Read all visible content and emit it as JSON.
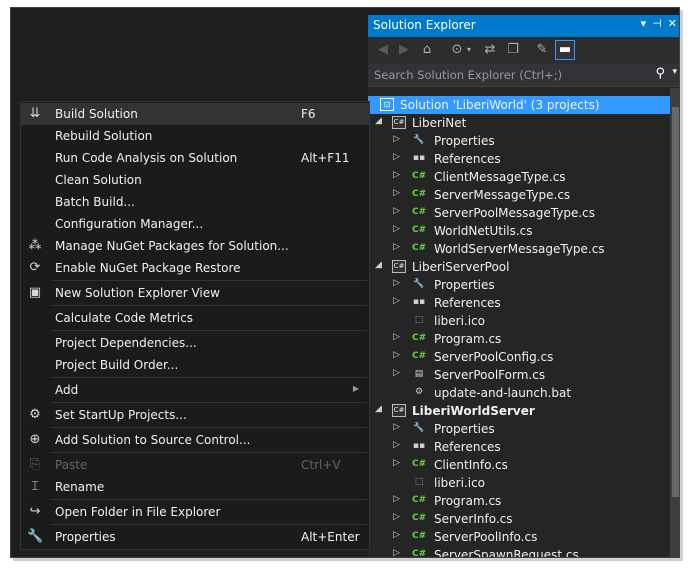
{
  "solution_explorer": {
    "title": "Solution Explorer",
    "title_buttons": [
      "▾",
      "⊣",
      "✕"
    ],
    "search_placeholder": "Search Solution Explorer (Ctrl+;)",
    "tree": [
      {
        "label": "Solution 'LiberiWorld' (3 projects)",
        "icon": "solution-icon",
        "level": 0,
        "expand": "",
        "selected": true
      },
      {
        "label": "LiberiNet",
        "icon": "csharp-project-icon",
        "level": 0,
        "expand": "open"
      },
      {
        "label": "Properties",
        "icon": "wrench-icon",
        "level": 1,
        "expand": "closed"
      },
      {
        "label": "References",
        "icon": "references-icon",
        "level": 1,
        "expand": "closed"
      },
      {
        "label": "ClientMessageType.cs",
        "icon": "csharp-file-icon",
        "level": 1,
        "expand": "closed"
      },
      {
        "label": "ServerMessageType.cs",
        "icon": "csharp-file-icon",
        "level": 1,
        "expand": "closed"
      },
      {
        "label": "ServerPoolMessageType.cs",
        "icon": "csharp-file-icon",
        "level": 1,
        "expand": "closed"
      },
      {
        "label": "WorldNetUtils.cs",
        "icon": "csharp-file-icon",
        "level": 1,
        "expand": "closed"
      },
      {
        "label": "WorldServerMessageType.cs",
        "icon": "csharp-file-icon",
        "level": 1,
        "expand": "closed"
      },
      {
        "label": "LiberiServerPool",
        "icon": "csharp-project-icon",
        "level": 0,
        "expand": "open"
      },
      {
        "label": "Properties",
        "icon": "wrench-icon",
        "level": 1,
        "expand": "closed"
      },
      {
        "label": "References",
        "icon": "references-icon",
        "level": 1,
        "expand": "closed"
      },
      {
        "label": "liberi.ico",
        "icon": "ico-file-icon",
        "level": 1,
        "expand": ""
      },
      {
        "label": "Program.cs",
        "icon": "csharp-file-icon",
        "level": 1,
        "expand": "closed"
      },
      {
        "label": "ServerPoolConfig.cs",
        "icon": "csharp-file-icon",
        "level": 1,
        "expand": "closed"
      },
      {
        "label": "ServerPoolForm.cs",
        "icon": "form-file-icon",
        "level": 1,
        "expand": "closed"
      },
      {
        "label": "update-and-launch.bat",
        "icon": "bat-file-icon",
        "level": 1,
        "expand": ""
      },
      {
        "label": "LiberiWorldServer",
        "icon": "csharp-project-icon",
        "level": 0,
        "expand": "open",
        "bold": true
      },
      {
        "label": "Properties",
        "icon": "wrench-icon",
        "level": 1,
        "expand": "closed"
      },
      {
        "label": "References",
        "icon": "references-icon",
        "level": 1,
        "expand": "closed"
      },
      {
        "label": "ClientInfo.cs",
        "icon": "csharp-file-icon",
        "level": 1,
        "expand": "closed"
      },
      {
        "label": "liberi.ico",
        "icon": "ico-file-icon",
        "level": 1,
        "expand": ""
      },
      {
        "label": "Program.cs",
        "icon": "csharp-file-icon",
        "level": 1,
        "expand": "closed"
      },
      {
        "label": "ServerInfo.cs",
        "icon": "csharp-file-icon",
        "level": 1,
        "expand": "closed"
      },
      {
        "label": "ServerPoolInfo.cs",
        "icon": "csharp-file-icon",
        "level": 1,
        "expand": "closed"
      },
      {
        "label": "ServerSpawnRequest.cs",
        "icon": "csharp-file-icon",
        "level": 1,
        "expand": "closed"
      }
    ]
  },
  "context_menu": {
    "items": [
      {
        "label": "Build Solution",
        "shortcut": "F6",
        "icon": "build-icon",
        "highlighted": true
      },
      {
        "label": "Rebuild Solution",
        "shortcut": ""
      },
      {
        "label": "Run Code Analysis on Solution",
        "shortcut": "Alt+F11"
      },
      {
        "label": "Clean Solution",
        "shortcut": ""
      },
      {
        "label": "Batch Build...",
        "shortcut": ""
      },
      {
        "label": "Configuration Manager...",
        "shortcut": ""
      },
      {
        "label": "Manage NuGet Packages for Solution...",
        "shortcut": "",
        "icon": "nuget-icon"
      },
      {
        "label": "Enable NuGet Package Restore",
        "shortcut": "",
        "icon": "package-restore-icon"
      },
      {
        "separator": true
      },
      {
        "label": "New Solution Explorer View",
        "shortcut": "",
        "icon": "new-view-icon"
      },
      {
        "separator": true
      },
      {
        "label": "Calculate Code Metrics",
        "shortcut": ""
      },
      {
        "separator": true
      },
      {
        "label": "Project Dependencies...",
        "shortcut": ""
      },
      {
        "label": "Project Build Order...",
        "shortcut": ""
      },
      {
        "separator": true
      },
      {
        "label": "Add",
        "shortcut": "",
        "submenu": true
      },
      {
        "separator": true
      },
      {
        "label": "Set StartUp Projects...",
        "shortcut": "",
        "icon": "gear-icon"
      },
      {
        "separator": true
      },
      {
        "label": "Add Solution to Source Control...",
        "shortcut": "",
        "icon": "source-control-icon"
      },
      {
        "separator": true
      },
      {
        "label": "Paste",
        "shortcut": "Ctrl+V",
        "icon": "paste-icon",
        "disabled": true
      },
      {
        "label": "Rename",
        "shortcut": "",
        "icon": "rename-icon"
      },
      {
        "separator": true
      },
      {
        "label": "Open Folder in File Explorer",
        "shortcut": "",
        "icon": "open-folder-icon"
      },
      {
        "separator": true
      },
      {
        "label": "Properties",
        "shortcut": "Alt+Enter",
        "icon": "wrench-icon"
      }
    ]
  }
}
